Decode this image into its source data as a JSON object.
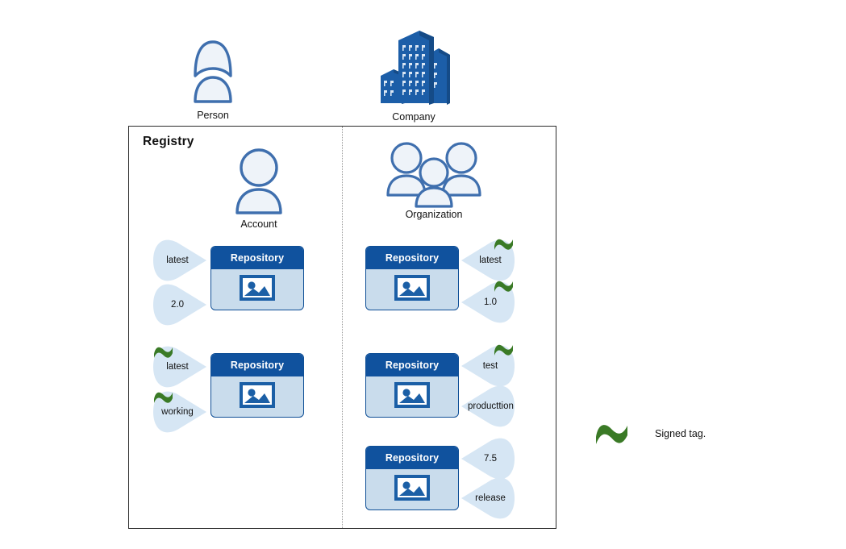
{
  "diagram": {
    "title": "Registry",
    "actors": [
      {
        "name": "person",
        "label": "Person",
        "icon": "person-icon"
      },
      {
        "name": "company",
        "label": "Company",
        "icon": "company-building-icon"
      }
    ],
    "owners": [
      {
        "name": "account",
        "label": "Account",
        "icon": "account-user-icon"
      },
      {
        "name": "organization",
        "label": "Organization",
        "icon": "organization-users-icon"
      }
    ],
    "repository_label": "Repository",
    "repository_icon": "image-icon",
    "columns": [
      {
        "name": "account-column",
        "side": "left",
        "repositories": [
          {
            "name": "account-repository-1",
            "tags": [
              {
                "label": "latest",
                "signed": false
              },
              {
                "label": "2.0",
                "signed": false
              }
            ]
          },
          {
            "name": "account-repository-2",
            "tags": [
              {
                "label": "latest",
                "signed": true
              },
              {
                "label": "working",
                "signed": true
              }
            ]
          }
        ]
      },
      {
        "name": "organization-column",
        "side": "right",
        "repositories": [
          {
            "name": "organization-repository-1",
            "tags": [
              {
                "label": "latest",
                "signed": true
              },
              {
                "label": "1.0",
                "signed": true
              }
            ]
          },
          {
            "name": "organization-repository-2",
            "tags": [
              {
                "label": "test",
                "signed": true
              },
              {
                "label": "producttion",
                "signed": false
              }
            ]
          },
          {
            "name": "organization-repository-3",
            "tags": [
              {
                "label": "7.5",
                "signed": false
              },
              {
                "label": "release",
                "signed": false
              }
            ]
          }
        ]
      }
    ],
    "legend": {
      "icon": "signed-tag-squiggle-icon",
      "text": "Signed tag."
    },
    "colors": {
      "repo_header": "#10529e",
      "repo_body": "#c9dcec",
      "repo_border": "#0f4f96",
      "tag_fill": "#d6e6f4",
      "icon_stroke": "#3f6fae",
      "icon_fill": "#eef3f9",
      "building_blue": "#1c5ea8",
      "signed_green": "#3a7a26",
      "frame": "#2b2b2b",
      "divider": "#9a9a9a"
    }
  }
}
